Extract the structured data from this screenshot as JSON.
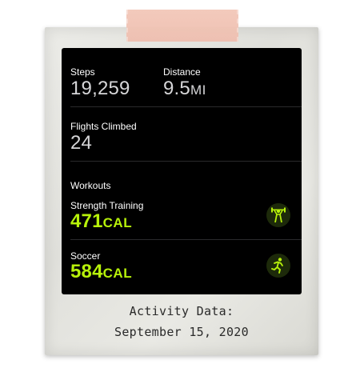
{
  "summary": {
    "steps": {
      "label": "Steps",
      "value": "19,259"
    },
    "distance": {
      "label": "Distance",
      "value": "9.5",
      "unit": "MI"
    },
    "flights": {
      "label": "Flights Climbed",
      "value": "24"
    }
  },
  "workouts": {
    "heading": "Workouts",
    "items": [
      {
        "name": "Strength Training",
        "value": "471",
        "unit": "CAL",
        "icon": "weightlifting-icon"
      },
      {
        "name": "Soccer",
        "value": "584",
        "unit": "CAL",
        "icon": "running-icon"
      }
    ]
  },
  "caption": {
    "line1": "Activity Data:",
    "line2": "September 15, 2020"
  },
  "colors": {
    "accent": "#b7f20a",
    "screen": "#000000",
    "frame": "#e4e4df",
    "tape": "#f1c4b5"
  }
}
